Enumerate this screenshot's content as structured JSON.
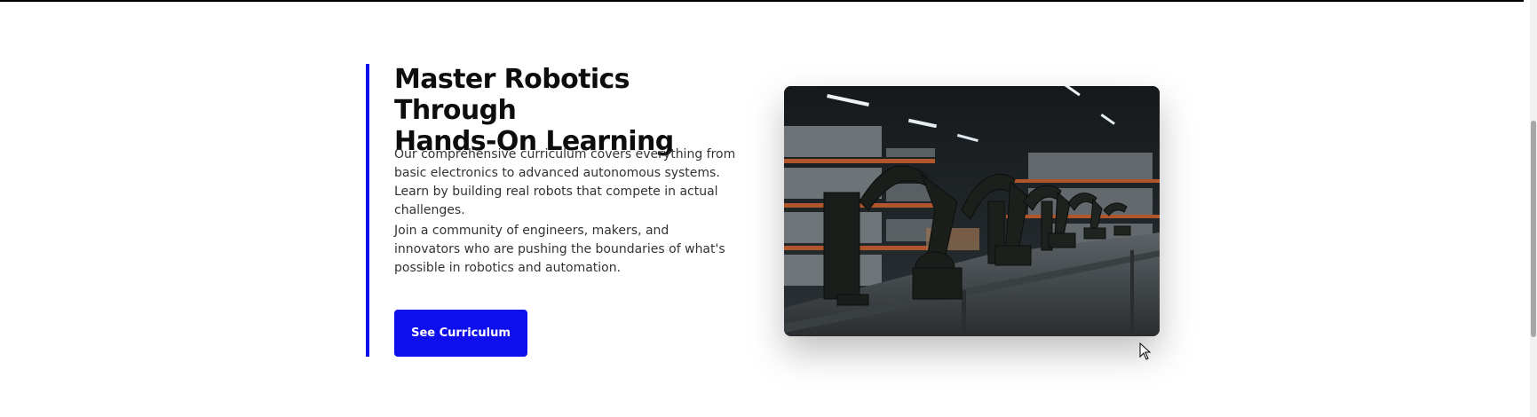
{
  "section": {
    "title_line1": "Master Robotics Through",
    "title_line2": "Hands-On Learning",
    "paragraph1": "Our comprehensive curriculum covers everything from basic electronics to advanced autonomous systems. Learn by building real robots that compete in actual challenges.",
    "paragraph2": "Join a community of engineers, makers, and innovators who are pushing the boundaries of what's possible in robotics and automation.",
    "cta_label": "See Curriculum"
  },
  "colors": {
    "accent": "#0f0fee",
    "heading": "#0d0d0d",
    "body_text": "#333333"
  },
  "image": {
    "subject": "robotic-arms-warehouse-photo"
  }
}
